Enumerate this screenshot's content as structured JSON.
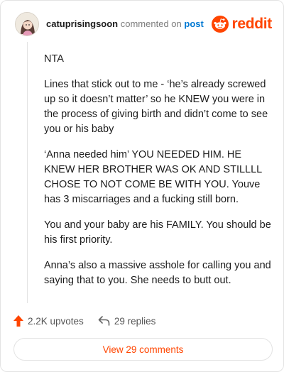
{
  "header": {
    "username": "catuprisingsoon",
    "action": "commented on",
    "target": "post",
    "brand": "reddit",
    "avatar_icon": "avatar-icon",
    "brand_icon": "reddit-snoo-icon"
  },
  "comment": {
    "paragraphs": [
      "NTA",
      "Lines that stick out to me - ‘he’s already screwed up so it doesn’t matter’ so he KNEW you were in the process of giving birth and didn’t come to see you or his baby",
      "‘Anna needed him’ YOU NEEDED HIM. HE KNEW HER BROTHER WAS OK AND STILLLL CHOSE TO NOT COME BE WITH YOU. Youve has 3 miscarriages and a fucking still born.",
      "You and your baby are his FAMILY. You should be his first priority.",
      "Anna’s also a massive asshole for calling you and saying that to you. She needs to butt out."
    ]
  },
  "actions": {
    "upvotes": "2.2K upvotes",
    "replies": "29 replies",
    "upvote_icon": "upvote-arrow-icon",
    "reply_icon": "reply-arrow-icon"
  },
  "footer": {
    "view_comments": "View 29 comments"
  },
  "colors": {
    "accent": "#ff4500",
    "link": "#0079d3",
    "muted": "#7c7c7c",
    "border": "#e3e3e3"
  }
}
